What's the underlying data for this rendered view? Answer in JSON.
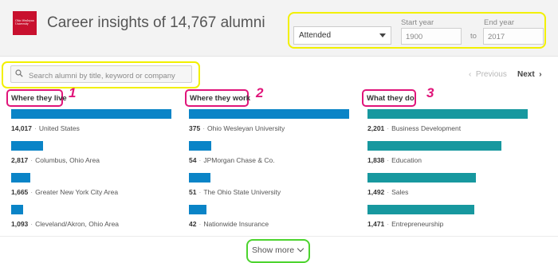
{
  "header": {
    "logo_text": "Ohio Wesleyan University",
    "title": "Career insights of 14,767 alumni",
    "filter": {
      "selected": "Attended",
      "start_label": "Start year",
      "start_value": "1900",
      "to_label": "to",
      "end_label": "End year",
      "end_value": "2017"
    }
  },
  "search": {
    "placeholder": "Search alumni by title, keyword or company"
  },
  "pager": {
    "previous": "Previous",
    "next": "Next"
  },
  "columns": [
    {
      "heading": "Where they live",
      "number": "1",
      "bar_color": "#0a84c7",
      "items": [
        {
          "count": "14,017",
          "label": "United States",
          "share": 1.0
        },
        {
          "count": "2,817",
          "label": "Columbus, Ohio Area",
          "share": 0.2
        },
        {
          "count": "1,665",
          "label": "Greater New York City Area",
          "share": 0.12
        },
        {
          "count": "1,093",
          "label": "Cleveland/Akron, Ohio Area",
          "share": 0.075
        }
      ]
    },
    {
      "heading": "Where they work",
      "number": "2",
      "bar_color": "#0a84c7",
      "items": [
        {
          "count": "375",
          "label": "Ohio Wesleyan University",
          "share": 1.0
        },
        {
          "count": "54",
          "label": "JPMorgan Chase & Co.",
          "share": 0.14
        },
        {
          "count": "51",
          "label": "The Ohio State University",
          "share": 0.135
        },
        {
          "count": "42",
          "label": "Nationwide Insurance",
          "share": 0.11
        }
      ]
    },
    {
      "heading": "What they do",
      "number": "3",
      "bar_color": "#17989f",
      "items": [
        {
          "count": "2,201",
          "label": "Business Development",
          "share": 1.0
        },
        {
          "count": "1,838",
          "label": "Education",
          "share": 0.835
        },
        {
          "count": "1,492",
          "label": "Sales",
          "share": 0.678
        },
        {
          "count": "1,471",
          "label": "Entrepreneurship",
          "share": 0.668
        }
      ]
    }
  ],
  "show_more": "Show more",
  "colors": {
    "brand": "#c8102e",
    "yellow_highlight": "#f2f000",
    "pink_highlight": "#e0157a",
    "green_highlight": "#4cd42e"
  }
}
